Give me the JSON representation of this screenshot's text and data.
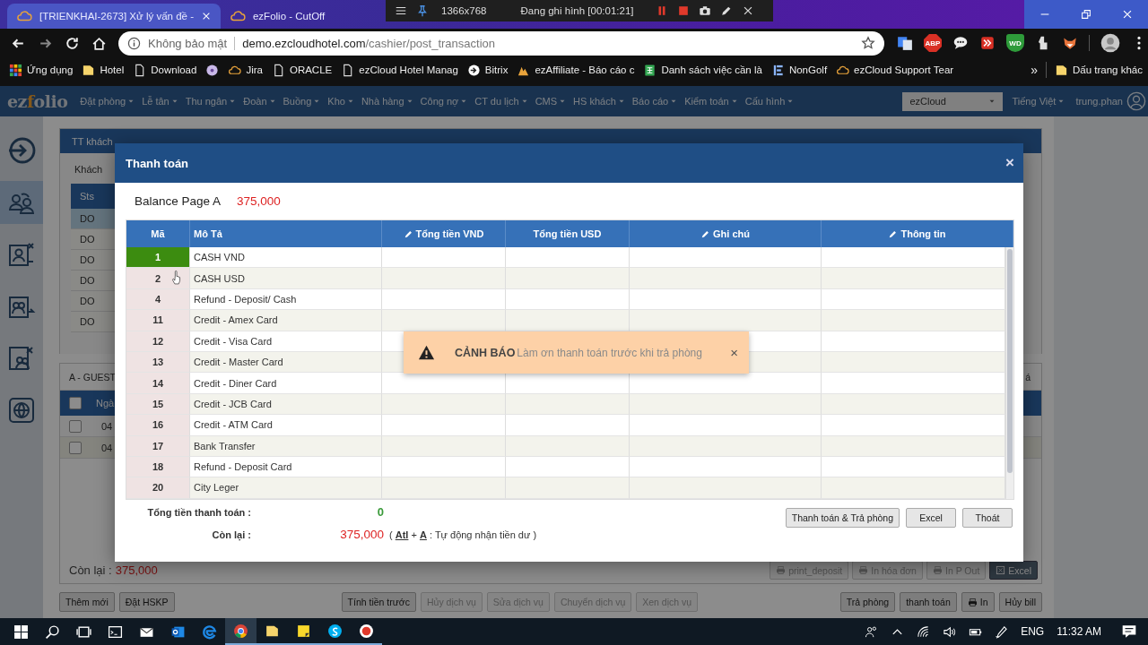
{
  "browser": {
    "tabs": [
      {
        "title": "[TRIENKHAI-2673] Xử lý vấn đề -",
        "selected": true,
        "closable": true
      },
      {
        "title": "ezFolio - CutOff",
        "selected": false,
        "closable": false
      }
    ],
    "recorder": {
      "resolution": "1366x768",
      "status": "Đang ghi hình [00:01:21]"
    },
    "address": {
      "security": "Không bảo mật",
      "host": "demo.ezcloudhotel.com",
      "path": "/cashier/post_transaction"
    },
    "extensions": [
      {
        "kind": "translate"
      },
      {
        "kind": "adblock",
        "label": "ABP"
      },
      {
        "kind": "chat"
      },
      {
        "kind": "forward"
      },
      {
        "kind": "shield",
        "label": "WD"
      },
      {
        "kind": "hand"
      },
      {
        "kind": "fox"
      }
    ],
    "bookmarks": [
      {
        "kind": "apps",
        "label": "Ứng dụng"
      },
      {
        "kind": "folder",
        "label": "Hotel"
      },
      {
        "kind": "page",
        "label": "Download"
      },
      {
        "kind": "disc"
      },
      {
        "kind": "cloud",
        "label": "Jira"
      },
      {
        "kind": "page",
        "label": "ORACLE"
      },
      {
        "kind": "page",
        "label": "ezCloud Hotel Manag"
      },
      {
        "kind": "bitrix",
        "label": "Bitrix"
      },
      {
        "kind": "peak",
        "label": "ezAffiliate - Báo cáo c"
      },
      {
        "kind": "sheet",
        "label": "Danh sách việc cần là"
      },
      {
        "kind": "stripes",
        "label": "NonGolf"
      },
      {
        "kind": "cloud",
        "label": "ezCloud Support Tear"
      }
    ],
    "overflow": "»",
    "other_bookmarks": "Dấu trang khác"
  },
  "app": {
    "logo": {
      "start": "ez",
      "accent": "f",
      "end": "olio"
    },
    "menu": [
      "Đặt phòng",
      "Lễ tân",
      "Thu ngân",
      "Đoàn",
      "Buồng",
      "Kho",
      "Nhà hàng",
      "Công nợ",
      "CT du lịch",
      "CMS",
      "HS khách",
      "Báo cáo",
      "Kiểm toán",
      "Cấu hình"
    ],
    "property": "ezCloud",
    "language": "Tiếng Việt",
    "user": "trung.phan"
  },
  "sidebar": [
    {
      "kind": "login",
      "selected": false
    },
    {
      "kind": "people",
      "selected": true
    },
    {
      "kind": "idcard",
      "selected": false
    },
    {
      "kind": "group",
      "selected": false
    },
    {
      "kind": "card-people",
      "selected": false
    },
    {
      "kind": "globe",
      "selected": false
    }
  ],
  "guest_panel": {
    "title": "TT khách",
    "label": "Khách",
    "column": "Sts",
    "rows": [
      {
        "status": "DO",
        "selected": true
      },
      {
        "status": "DO",
        "selected": false
      },
      {
        "status": "DO",
        "selected": false
      },
      {
        "status": "DO",
        "selected": false
      },
      {
        "status": "DO",
        "selected": false
      },
      {
        "status": "DO",
        "selected": false
      }
    ]
  },
  "folio_panel": {
    "title": "A - GUEST",
    "tab_fragment": "á",
    "column": "Ngà",
    "header_checked": false,
    "rows": [
      {
        "date": "04",
        "checked": false
      },
      {
        "date": "04",
        "checked": false
      }
    ],
    "balance_label": "Còn lại :",
    "balance": "375,000",
    "actions": [
      {
        "label": "print_deposit",
        "kind": "print",
        "disabled": true
      },
      {
        "label": "In hóa đơn",
        "kind": "print",
        "disabled": true
      },
      {
        "label": "In P Out",
        "kind": "print",
        "disabled": true
      },
      {
        "label": "Excel",
        "kind": "excel",
        "disabled": false
      }
    ]
  },
  "bottom_buttons": {
    "left": [
      {
        "label": "Thêm mới",
        "disabled": false
      },
      {
        "label": "Đặt HSKP",
        "disabled": false
      }
    ],
    "middle": [
      {
        "label": "Tính tiền trước",
        "disabled": false
      },
      {
        "label": "Hủy dịch vụ",
        "disabled": true
      },
      {
        "label": "Sửa dịch vụ",
        "disabled": true
      },
      {
        "label": "Chuyển dịch vụ",
        "disabled": true
      },
      {
        "label": "Xen dịch vụ",
        "disabled": true
      }
    ],
    "right": [
      {
        "label": "Trả phòng",
        "kind": "plain",
        "disabled": false
      },
      {
        "label": "thanh toán",
        "kind": "plain",
        "disabled": false
      },
      {
        "label": "In",
        "kind": "print",
        "disabled": false
      },
      {
        "label": "Hủy bill",
        "kind": "plain",
        "disabled": false
      }
    ]
  },
  "modal": {
    "title": "Thanh toán",
    "close": "×",
    "balance_label": "Balance Page A",
    "balance": "375,000",
    "columns": [
      {
        "label": "Mã",
        "editable": false
      },
      {
        "label": "Mô Tả",
        "editable": false
      },
      {
        "label": "Tổng tiền VND",
        "editable": true
      },
      {
        "label": "Tổng tiền USD",
        "editable": false
      },
      {
        "label": "Ghi chú",
        "editable": true
      },
      {
        "label": "Thông tin",
        "editable": true
      }
    ],
    "rows": [
      {
        "code": "1",
        "description": "CASH VND",
        "selected": true
      },
      {
        "code": "2",
        "description": "CASH USD",
        "selected": false
      },
      {
        "code": "4",
        "description": "Refund - Deposit/ Cash",
        "selected": false
      },
      {
        "code": "11",
        "description": "Credit - Amex Card",
        "selected": false
      },
      {
        "code": "12",
        "description": "Credit - Visa Card",
        "selected": false
      },
      {
        "code": "13",
        "description": "Credit - Master Card",
        "selected": false
      },
      {
        "code": "14",
        "description": "Credit - Diner Card",
        "selected": false
      },
      {
        "code": "15",
        "description": "Credit - JCB Card",
        "selected": false
      },
      {
        "code": "16",
        "description": "Credit - ATM Card",
        "selected": false
      },
      {
        "code": "17",
        "description": "Bank Transfer",
        "selected": false
      },
      {
        "code": "18",
        "description": "Refund - Deposit Card",
        "selected": false
      },
      {
        "code": "20",
        "description": "City Leger",
        "selected": false
      }
    ],
    "total_label": "Tổng tiền thanh toán :",
    "total": "0",
    "remaining_label": "Còn lại :",
    "remaining": "375,000",
    "hint": "( **Atl** + **A** : Tự động nhận tiền dư )",
    "buttons": [
      "Thanh toán & Trả phòng",
      "Excel",
      "Thoát"
    ]
  },
  "toast": {
    "title": "CẢNH BÁO",
    "message": "Làm ơn thanh toán trước khi trả phòng",
    "close": "×"
  },
  "taskbar": {
    "apps": [
      {
        "kind": "search",
        "running": false,
        "selected": false
      },
      {
        "kind": "taskview",
        "running": false,
        "selected": false
      },
      {
        "kind": "terminal",
        "running": false,
        "selected": false
      },
      {
        "kind": "mail",
        "running": false,
        "selected": false
      },
      {
        "kind": "mailapp",
        "running": false,
        "selected": false
      },
      {
        "kind": "swirl",
        "running": false,
        "selected": false
      },
      {
        "kind": "browser",
        "running": true,
        "selected": true
      },
      {
        "kind": "folder",
        "running": true,
        "selected": false
      },
      {
        "kind": "note",
        "running": true,
        "selected": false
      },
      {
        "kind": "chatapp",
        "running": true,
        "selected": false
      },
      {
        "kind": "record",
        "running": true,
        "selected": false
      }
    ],
    "language": "ENG",
    "time": "11:32 AM"
  }
}
